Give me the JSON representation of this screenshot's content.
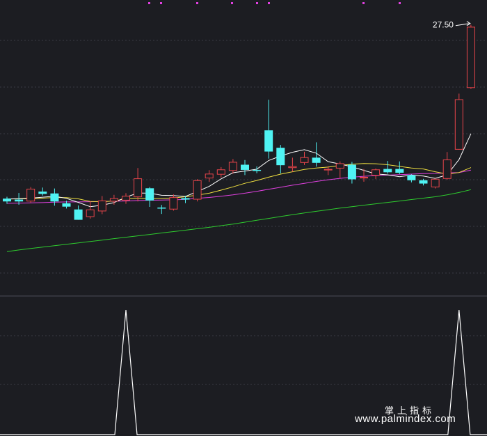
{
  "chart_data": [
    {
      "type": "candlestick",
      "peak_label": "27.50",
      "y_range_price": [
        16.3,
        28.4
      ],
      "colors": {
        "up": "#e8454a",
        "down": "#4ff3f3",
        "ma5": "#ffffff",
        "ma10": "#f0e040",
        "ma20": "#e040e0",
        "ma60": "#2ecc2e",
        "grid": "#3a3c44"
      },
      "candles": [
        {
          "o": 20.2,
          "c": 20.08,
          "h": 20.28,
          "l": 19.98
        },
        {
          "o": 20.16,
          "c": 20.08,
          "h": 20.44,
          "l": 19.94
        },
        {
          "o": 20.08,
          "c": 20.62,
          "h": 20.69,
          "l": 20.02
        },
        {
          "o": 20.5,
          "c": 20.4,
          "h": 20.67,
          "l": 20.33
        },
        {
          "o": 20.42,
          "c": 20.08,
          "h": 20.63,
          "l": 19.9
        },
        {
          "o": 20.0,
          "c": 19.86,
          "h": 20.11,
          "l": 19.78
        },
        {
          "o": 19.74,
          "c": 19.3,
          "h": 19.91,
          "l": 19.3
        },
        {
          "o": 19.42,
          "c": 19.74,
          "h": 20.09,
          "l": 19.35
        },
        {
          "o": 19.66,
          "c": 20.12,
          "h": 20.31,
          "l": 19.54
        },
        {
          "o": 20.08,
          "c": 20.22,
          "h": 20.36,
          "l": 19.94
        },
        {
          "o": 20.12,
          "c": 20.32,
          "h": 20.43,
          "l": 19.98
        },
        {
          "o": 20.26,
          "c": 21.06,
          "h": 21.5,
          "l": 20.08
        },
        {
          "o": 20.64,
          "c": 20.12,
          "h": 20.69,
          "l": 19.85
        },
        {
          "o": 19.82,
          "c": 19.78,
          "h": 19.93,
          "l": 19.55
        },
        {
          "o": 19.74,
          "c": 20.26,
          "h": 20.38,
          "l": 19.69
        },
        {
          "o": 20.22,
          "c": 20.16,
          "h": 20.32,
          "l": 20.01
        },
        {
          "o": 20.16,
          "c": 20.98,
          "h": 21.03,
          "l": 20.08
        },
        {
          "o": 21.06,
          "c": 21.26,
          "h": 21.41,
          "l": 20.91
        },
        {
          "o": 21.22,
          "c": 21.44,
          "h": 21.54,
          "l": 21.1
        },
        {
          "o": 21.38,
          "c": 21.76,
          "h": 21.88,
          "l": 21.26
        },
        {
          "o": 21.64,
          "c": 21.42,
          "h": 21.84,
          "l": 21.2
        },
        {
          "o": 21.42,
          "c": 21.4,
          "h": 21.57,
          "l": 21.28
        },
        {
          "o": 23.1,
          "c": 22.2,
          "h": 24.4,
          "l": 21.9
        },
        {
          "o": 22.36,
          "c": 21.62,
          "h": 22.48,
          "l": 21.27
        },
        {
          "o": 21.5,
          "c": 21.58,
          "h": 21.94,
          "l": 21.34
        },
        {
          "o": 21.72,
          "c": 21.96,
          "h": 22.19,
          "l": 21.63
        },
        {
          "o": 21.94,
          "c": 21.72,
          "h": 22.59,
          "l": 21.56
        },
        {
          "o": 21.4,
          "c": 21.46,
          "h": 21.58,
          "l": 21.2
        },
        {
          "o": 21.48,
          "c": 21.7,
          "h": 21.78,
          "l": 21.07
        },
        {
          "o": 21.64,
          "c": 21.02,
          "h": 21.76,
          "l": 20.84
        },
        {
          "o": 21.06,
          "c": 21.12,
          "h": 21.46,
          "l": 20.92
        },
        {
          "o": 21.18,
          "c": 21.44,
          "h": 21.48,
          "l": 21.03
        },
        {
          "o": 21.46,
          "c": 21.32,
          "h": 21.8,
          "l": 21.26
        },
        {
          "o": 21.46,
          "c": 21.3,
          "h": 21.78,
          "l": 21.24
        },
        {
          "o": 21.2,
          "c": 20.98,
          "h": 21.23,
          "l": 20.89
        },
        {
          "o": 20.98,
          "c": 20.84,
          "h": 21.04,
          "l": 20.76
        },
        {
          "o": 20.68,
          "c": 21.04,
          "h": 21.06,
          "l": 20.63
        },
        {
          "o": 21.04,
          "c": 21.86,
          "h": 22.18,
          "l": 21.0
        },
        {
          "o": 22.28,
          "c": 24.42,
          "h": 24.66,
          "l": 22.28
        },
        {
          "o": 24.9,
          "c": 27.5,
          "h": 27.58,
          "l": 24.86
        }
      ],
      "ma5": [
        20.18,
        20.2,
        20.22,
        20.26,
        20.3,
        20.21,
        20.04,
        19.86,
        19.92,
        20.03,
        20.26,
        20.44,
        20.43,
        20.34,
        20.33,
        20.29,
        20.5,
        20.72,
        21.04,
        21.3,
        21.37,
        21.45,
        21.82,
        22.01,
        22.17,
        22.28,
        22.13,
        21.77,
        21.67,
        21.55,
        21.4,
        21.25,
        21.21,
        21.13,
        21.2,
        21.16,
        21.06,
        21.21,
        21.86,
        22.96
      ],
      "ma10": [
        20.18,
        20.19,
        20.2,
        20.22,
        20.25,
        20.24,
        20.19,
        20.08,
        20.07,
        20.1,
        20.2,
        20.22,
        20.2,
        20.21,
        20.23,
        20.28,
        20.35,
        20.43,
        20.56,
        20.7,
        20.85,
        20.97,
        21.11,
        21.24,
        21.34,
        21.44,
        21.5,
        21.54,
        21.61,
        21.66,
        21.69,
        21.68,
        21.64,
        21.57,
        21.5,
        21.46,
        21.34,
        21.24,
        21.31,
        21.52
      ],
      "ma20": [
        20.0,
        20.01,
        20.02,
        20.03,
        20.05,
        20.06,
        20.06,
        20.07,
        20.08,
        20.09,
        20.1,
        20.12,
        20.13,
        20.14,
        20.15,
        20.17,
        20.21,
        20.25,
        20.3,
        20.36,
        20.43,
        20.51,
        20.6,
        20.68,
        20.77,
        20.85,
        20.93,
        21.0,
        21.06,
        21.11,
        21.15,
        21.18,
        21.2,
        21.22,
        21.24,
        21.26,
        21.27,
        21.29,
        21.31,
        21.41
      ],
      "ma60": [
        17.95,
        18.02,
        18.08,
        18.14,
        18.2,
        18.26,
        18.32,
        18.38,
        18.44,
        18.5,
        18.56,
        18.62,
        18.68,
        18.74,
        18.8,
        18.86,
        18.92,
        18.98,
        19.05,
        19.12,
        19.2,
        19.28,
        19.36,
        19.44,
        19.52,
        19.59,
        19.66,
        19.73,
        19.8,
        19.86,
        19.92,
        19.98,
        20.04,
        20.1,
        20.16,
        20.22,
        20.28,
        20.36,
        20.46,
        20.58
      ]
    },
    {
      "type": "line",
      "signal_color": "#ffffff",
      "values": [
        0,
        0,
        0,
        0,
        0,
        0,
        0,
        0,
        0,
        0,
        0,
        0,
        0,
        0,
        0,
        0,
        0,
        0,
        0,
        0,
        0,
        0,
        0,
        0,
        0,
        0,
        0,
        0,
        0,
        0,
        0,
        0,
        0,
        0,
        0,
        0,
        0,
        0,
        0,
        0
      ],
      "spikes": [
        10,
        38
      ],
      "y_range": [
        0,
        1
      ]
    }
  ],
  "watermark": {
    "line1": "掌上指标",
    "line2": "www.palmindex.com"
  },
  "top_markers_color": "#e040e0"
}
